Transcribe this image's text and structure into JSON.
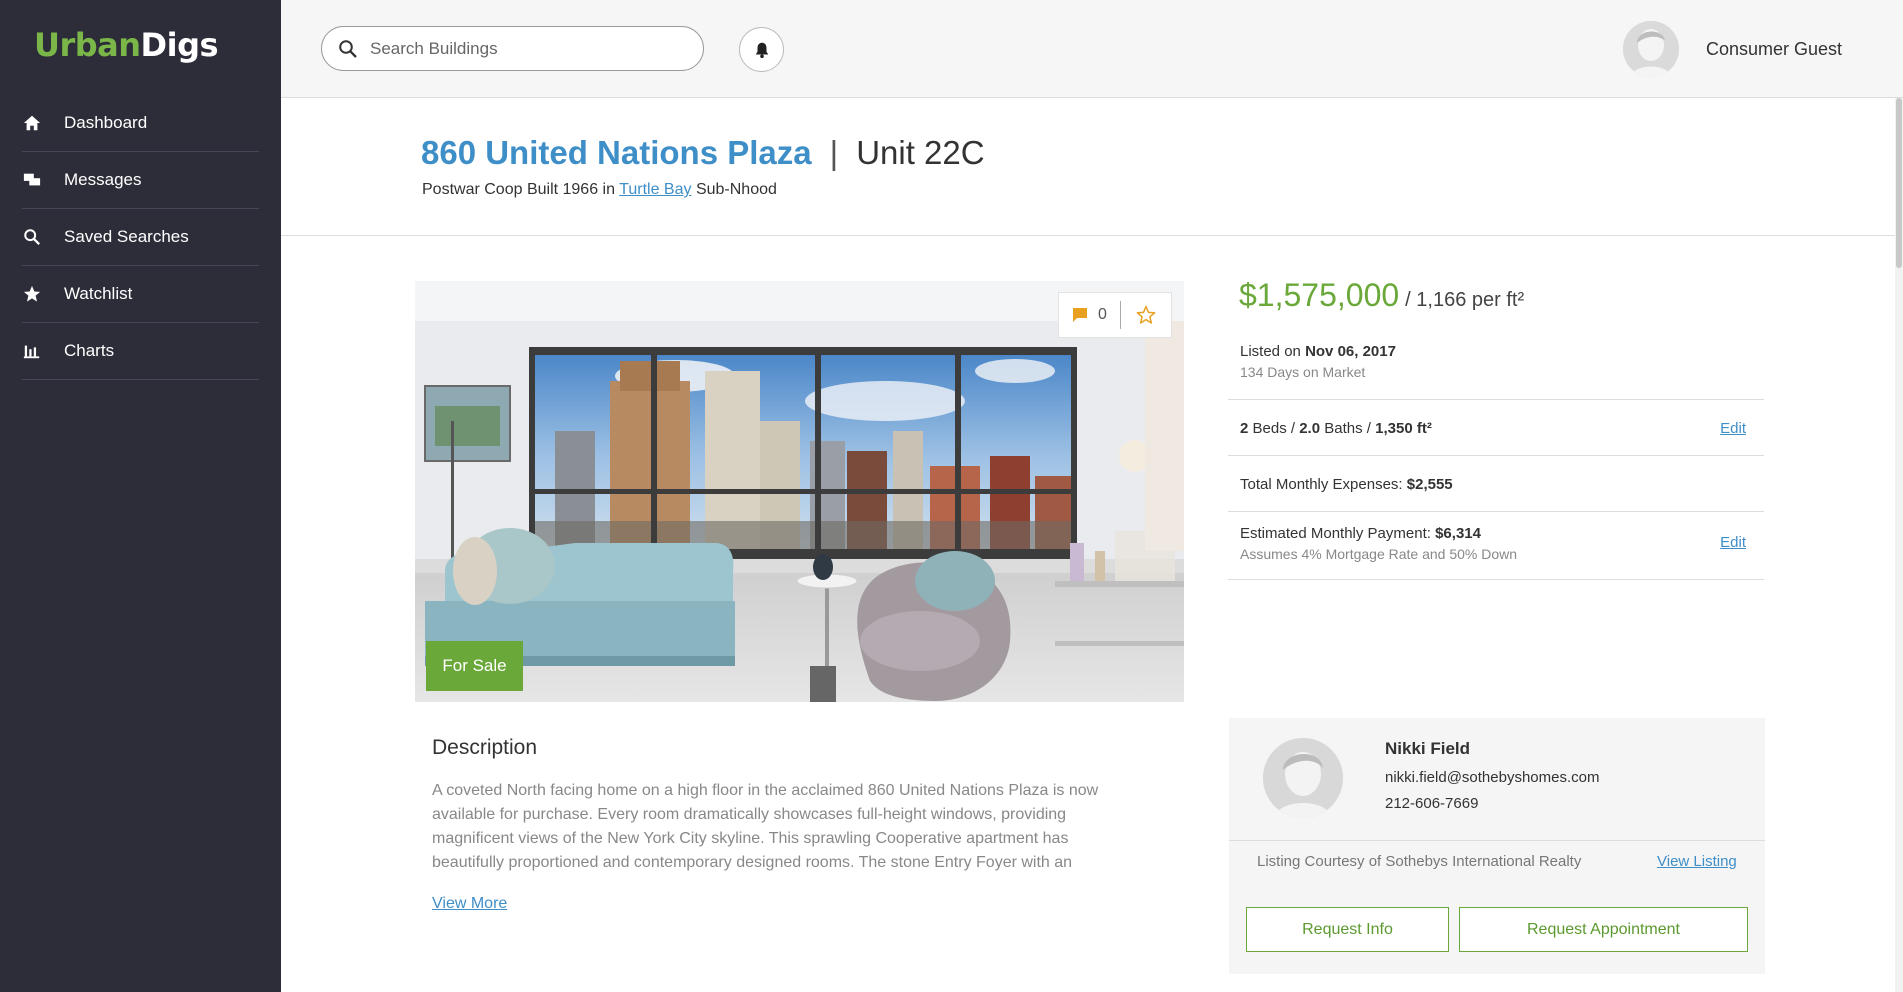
{
  "app": {
    "logo_part1": "Urban",
    "logo_part2": "Digs",
    "brand_green": "#6aa83a",
    "link_blue": "#3e8ec8",
    "sidebar_bg": "#2d2d3a"
  },
  "sidebar": {
    "items": [
      {
        "label": "Dashboard",
        "icon": "home-icon"
      },
      {
        "label": "Messages",
        "icon": "messages-icon"
      },
      {
        "label": "Saved Searches",
        "icon": "search-icon"
      },
      {
        "label": "Watchlist",
        "icon": "star-icon"
      },
      {
        "label": "Charts",
        "icon": "bar-chart-icon"
      }
    ]
  },
  "header": {
    "search_placeholder": "Search Buildings",
    "user_name": "Consumer Guest"
  },
  "listing": {
    "address": "860 United Nations Plaza",
    "separator": "|",
    "unit": "Unit 22C",
    "subtitle_prefix": "Postwar Coop Built 1966 in",
    "neighborhood": "Turtle Bay",
    "subtitle_suffix": "Sub-Nhood",
    "comment_count": "0",
    "status_badge": "For Sale",
    "price": "$1,575,000",
    "price_per_ft": "/ 1,166 per ft²",
    "listed_label": "Listed on",
    "listed_date": "Nov 06, 2017",
    "days_on_market": "134 Days on Market",
    "beds": "2",
    "beds_label": "Beds /",
    "baths": "2.0",
    "baths_label": "Baths /",
    "size": "1,350 ft²",
    "edit_label": "Edit",
    "monthly_expenses_label": "Total Monthly Expenses:",
    "monthly_expenses": "$2,555",
    "est_payment_label": "Estimated Monthly Payment:",
    "est_payment": "$6,314",
    "est_payment_note": "Assumes 4% Mortgage Rate and 50% Down"
  },
  "description": {
    "title": "Description",
    "body": "A coveted North facing home on a high floor in the acclaimed 860 United Nations Plaza is now available for purchase. Every room dramatically showcases full-height windows, providing magnificent views of the New York City skyline. This sprawling Cooperative apartment has beautifully proportioned and contemporary designed rooms. The stone Entry Foyer with an",
    "view_more": "View More"
  },
  "agent": {
    "name": "Nikki Field",
    "email": "nikki.field@sothebyshomes.com",
    "phone": "212-606-7669",
    "courtesy": "Listing Courtesy of Sothebys International Realty",
    "view_listing": "View Listing",
    "request_info": "Request Info",
    "request_appointment": "Request Appointment"
  }
}
